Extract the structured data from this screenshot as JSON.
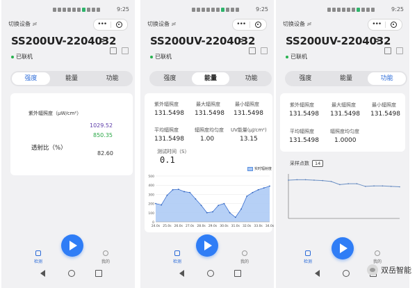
{
  "common": {
    "time": "9:25",
    "switch_device": "切换设备 ≓",
    "device_title": "SS200UV-2204032",
    "chevron": ">",
    "status": "已联机",
    "capsule_dots": "•••",
    "tabs": [
      "强度",
      "能量",
      "功能"
    ],
    "nav": {
      "detect": "检测",
      "mine": "我的"
    }
  },
  "screen1": {
    "active_tab": 0,
    "uv_label": "紫外辐照度（μW/cm²）",
    "uv_value_1": "1029.52",
    "uv_value_2": "850.35",
    "transmittance_label": "透射比（%）",
    "transmittance_value": "82.60",
    "colors": {
      "value1": "#5b3aa8",
      "value2": "#28a745"
    }
  },
  "screen2": {
    "active_tab": 1,
    "metrics_row1": [
      {
        "label": "紫外辐照度",
        "value": "131.5498"
      },
      {
        "label": "最大辐照度",
        "value": "131.5498"
      },
      {
        "label": "最小辐照度",
        "value": "131.5498"
      }
    ],
    "metrics_row2": [
      {
        "label": "平均辐照度",
        "value": "131.5498"
      },
      {
        "label": "辐照度均匀度",
        "value": "1.00"
      },
      {
        "label": "UV能量(μJ/cm²)",
        "value": "13.15"
      }
    ],
    "test_time_label": "测试时间（S）",
    "test_time_value": "0.1",
    "legend": "实时辐射度"
  },
  "screen3": {
    "active_tab": 2,
    "metrics_row1": [
      {
        "label": "紫外辐照度",
        "value": "131.5498"
      },
      {
        "label": "最大辐照度",
        "value": "131.5498"
      },
      {
        "label": "最小辐照度",
        "value": "131.5498"
      }
    ],
    "metrics_row2": [
      {
        "label": "平均辐照度",
        "value": "131.5498"
      },
      {
        "label": "辐照度均匀度",
        "value": "1.0000"
      }
    ],
    "sample_label": "采样点数",
    "sample_value": "14"
  },
  "watermark": "双岳智能",
  "chart_data": [
    {
      "type": "area",
      "chart": "screen2 real-time irradiance",
      "x_ticks": [
        "24.0s",
        "25.0s",
        "26.0s",
        "27.0s",
        "28.0s",
        "29.0s",
        "30.0s",
        "31.0s",
        "32.0s",
        "33.0s",
        "34.0s"
      ],
      "ylim": [
        0,
        500
      ],
      "y_ticks": [
        0,
        100,
        200,
        300,
        400,
        500
      ],
      "series": [
        {
          "name": "实时辐射度",
          "x": [
            24.0,
            24.5,
            25.0,
            25.5,
            26.0,
            26.5,
            27.0,
            27.5,
            28.0,
            28.5,
            29.0,
            29.5,
            30.0,
            30.5,
            31.0,
            31.5,
            32.0,
            32.5,
            33.0,
            33.5,
            34.0
          ],
          "values": [
            200,
            185,
            290,
            350,
            355,
            330,
            320,
            250,
            180,
            100,
            110,
            180,
            200,
            100,
            50,
            140,
            280,
            320,
            350,
            370,
            390
          ]
        }
      ],
      "grid": true,
      "legend": "top-right"
    },
    {
      "type": "line",
      "chart": "screen3 sample points",
      "x": [
        1,
        2,
        3,
        4,
        5,
        6,
        7,
        8,
        9,
        10,
        11,
        12,
        13,
        14
      ],
      "series": [
        {
          "values": [
            0.86,
            0.87,
            0.87,
            0.86,
            0.85,
            0.83,
            0.76,
            0.78,
            0.78,
            0.72,
            0.73,
            0.73,
            0.72,
            0.71
          ]
        }
      ],
      "ylim": [
        0,
        1
      ],
      "grid": false,
      "legend": "none"
    }
  ]
}
